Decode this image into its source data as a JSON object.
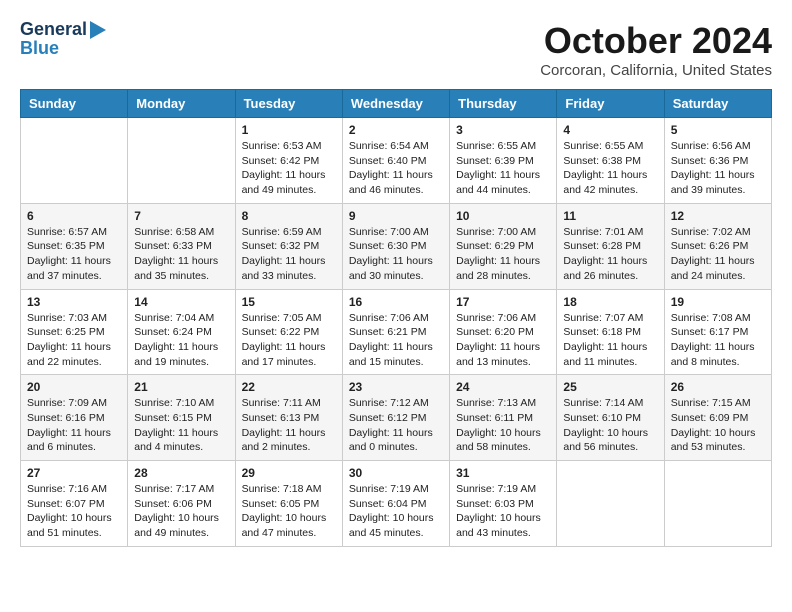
{
  "header": {
    "logo_line1": "General",
    "logo_line2": "Blue",
    "month_title": "October 2024",
    "location": "Corcoran, California, United States"
  },
  "days_of_week": [
    "Sunday",
    "Monday",
    "Tuesday",
    "Wednesday",
    "Thursday",
    "Friday",
    "Saturday"
  ],
  "weeks": [
    [
      {
        "day": "",
        "info": ""
      },
      {
        "day": "",
        "info": ""
      },
      {
        "day": "1",
        "info": "Sunrise: 6:53 AM\nSunset: 6:42 PM\nDaylight: 11 hours and 49 minutes."
      },
      {
        "day": "2",
        "info": "Sunrise: 6:54 AM\nSunset: 6:40 PM\nDaylight: 11 hours and 46 minutes."
      },
      {
        "day": "3",
        "info": "Sunrise: 6:55 AM\nSunset: 6:39 PM\nDaylight: 11 hours and 44 minutes."
      },
      {
        "day": "4",
        "info": "Sunrise: 6:55 AM\nSunset: 6:38 PM\nDaylight: 11 hours and 42 minutes."
      },
      {
        "day": "5",
        "info": "Sunrise: 6:56 AM\nSunset: 6:36 PM\nDaylight: 11 hours and 39 minutes."
      }
    ],
    [
      {
        "day": "6",
        "info": "Sunrise: 6:57 AM\nSunset: 6:35 PM\nDaylight: 11 hours and 37 minutes."
      },
      {
        "day": "7",
        "info": "Sunrise: 6:58 AM\nSunset: 6:33 PM\nDaylight: 11 hours and 35 minutes."
      },
      {
        "day": "8",
        "info": "Sunrise: 6:59 AM\nSunset: 6:32 PM\nDaylight: 11 hours and 33 minutes."
      },
      {
        "day": "9",
        "info": "Sunrise: 7:00 AM\nSunset: 6:30 PM\nDaylight: 11 hours and 30 minutes."
      },
      {
        "day": "10",
        "info": "Sunrise: 7:00 AM\nSunset: 6:29 PM\nDaylight: 11 hours and 28 minutes."
      },
      {
        "day": "11",
        "info": "Sunrise: 7:01 AM\nSunset: 6:28 PM\nDaylight: 11 hours and 26 minutes."
      },
      {
        "day": "12",
        "info": "Sunrise: 7:02 AM\nSunset: 6:26 PM\nDaylight: 11 hours and 24 minutes."
      }
    ],
    [
      {
        "day": "13",
        "info": "Sunrise: 7:03 AM\nSunset: 6:25 PM\nDaylight: 11 hours and 22 minutes."
      },
      {
        "day": "14",
        "info": "Sunrise: 7:04 AM\nSunset: 6:24 PM\nDaylight: 11 hours and 19 minutes."
      },
      {
        "day": "15",
        "info": "Sunrise: 7:05 AM\nSunset: 6:22 PM\nDaylight: 11 hours and 17 minutes."
      },
      {
        "day": "16",
        "info": "Sunrise: 7:06 AM\nSunset: 6:21 PM\nDaylight: 11 hours and 15 minutes."
      },
      {
        "day": "17",
        "info": "Sunrise: 7:06 AM\nSunset: 6:20 PM\nDaylight: 11 hours and 13 minutes."
      },
      {
        "day": "18",
        "info": "Sunrise: 7:07 AM\nSunset: 6:18 PM\nDaylight: 11 hours and 11 minutes."
      },
      {
        "day": "19",
        "info": "Sunrise: 7:08 AM\nSunset: 6:17 PM\nDaylight: 11 hours and 8 minutes."
      }
    ],
    [
      {
        "day": "20",
        "info": "Sunrise: 7:09 AM\nSunset: 6:16 PM\nDaylight: 11 hours and 6 minutes."
      },
      {
        "day": "21",
        "info": "Sunrise: 7:10 AM\nSunset: 6:15 PM\nDaylight: 11 hours and 4 minutes."
      },
      {
        "day": "22",
        "info": "Sunrise: 7:11 AM\nSunset: 6:13 PM\nDaylight: 11 hours and 2 minutes."
      },
      {
        "day": "23",
        "info": "Sunrise: 7:12 AM\nSunset: 6:12 PM\nDaylight: 11 hours and 0 minutes."
      },
      {
        "day": "24",
        "info": "Sunrise: 7:13 AM\nSunset: 6:11 PM\nDaylight: 10 hours and 58 minutes."
      },
      {
        "day": "25",
        "info": "Sunrise: 7:14 AM\nSunset: 6:10 PM\nDaylight: 10 hours and 56 minutes."
      },
      {
        "day": "26",
        "info": "Sunrise: 7:15 AM\nSunset: 6:09 PM\nDaylight: 10 hours and 53 minutes."
      }
    ],
    [
      {
        "day": "27",
        "info": "Sunrise: 7:16 AM\nSunset: 6:07 PM\nDaylight: 10 hours and 51 minutes."
      },
      {
        "day": "28",
        "info": "Sunrise: 7:17 AM\nSunset: 6:06 PM\nDaylight: 10 hours and 49 minutes."
      },
      {
        "day": "29",
        "info": "Sunrise: 7:18 AM\nSunset: 6:05 PM\nDaylight: 10 hours and 47 minutes."
      },
      {
        "day": "30",
        "info": "Sunrise: 7:19 AM\nSunset: 6:04 PM\nDaylight: 10 hours and 45 minutes."
      },
      {
        "day": "31",
        "info": "Sunrise: 7:19 AM\nSunset: 6:03 PM\nDaylight: 10 hours and 43 minutes."
      },
      {
        "day": "",
        "info": ""
      },
      {
        "day": "",
        "info": ""
      }
    ]
  ]
}
